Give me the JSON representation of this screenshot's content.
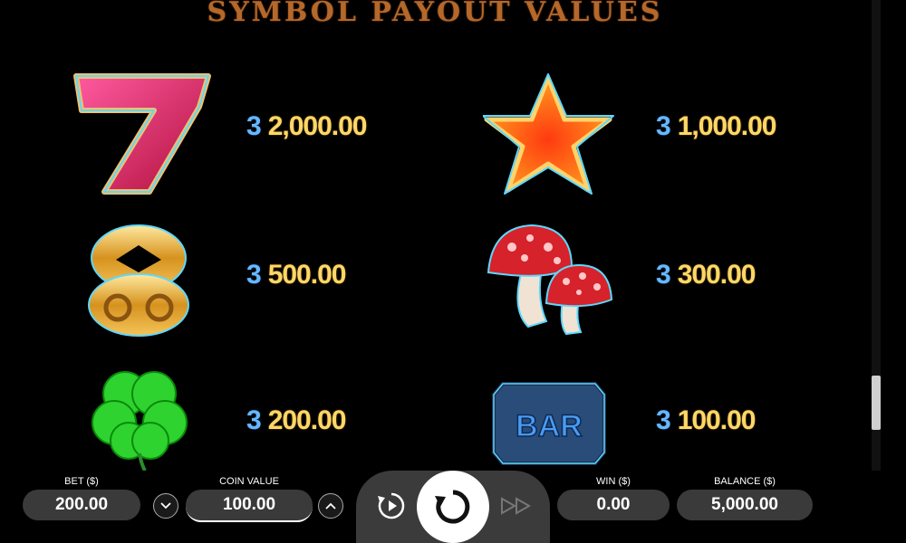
{
  "title": "SYMBOL PAYOUT VALUES",
  "payouts": [
    {
      "symbol": "red-seven-icon",
      "count": "3",
      "value": "2,000.00"
    },
    {
      "symbol": "star-icon",
      "count": "3",
      "value": "1,000.00"
    },
    {
      "symbol": "gold-eight-icon",
      "count": "3",
      "value": "500.00"
    },
    {
      "symbol": "mushroom-icon",
      "count": "3",
      "value": "300.00"
    },
    {
      "symbol": "clover-icon",
      "count": "3",
      "value": "200.00"
    },
    {
      "symbol": "bar-icon",
      "count": "3",
      "value": "100.00"
    }
  ],
  "bar_symbol_text": "BAR",
  "controls": {
    "bet_label": "BET ($)",
    "bet_value": "200.00",
    "coin_label": "COIN VALUE",
    "coin_value": "100.00",
    "win_label": "WIN ($)",
    "win_value": "0.00",
    "balance_label": "BALANCE ($)",
    "balance_value": "5,000.00"
  },
  "colors": {
    "count": "#66b8ff",
    "value": "#ffd766",
    "title": "#b5682a"
  }
}
